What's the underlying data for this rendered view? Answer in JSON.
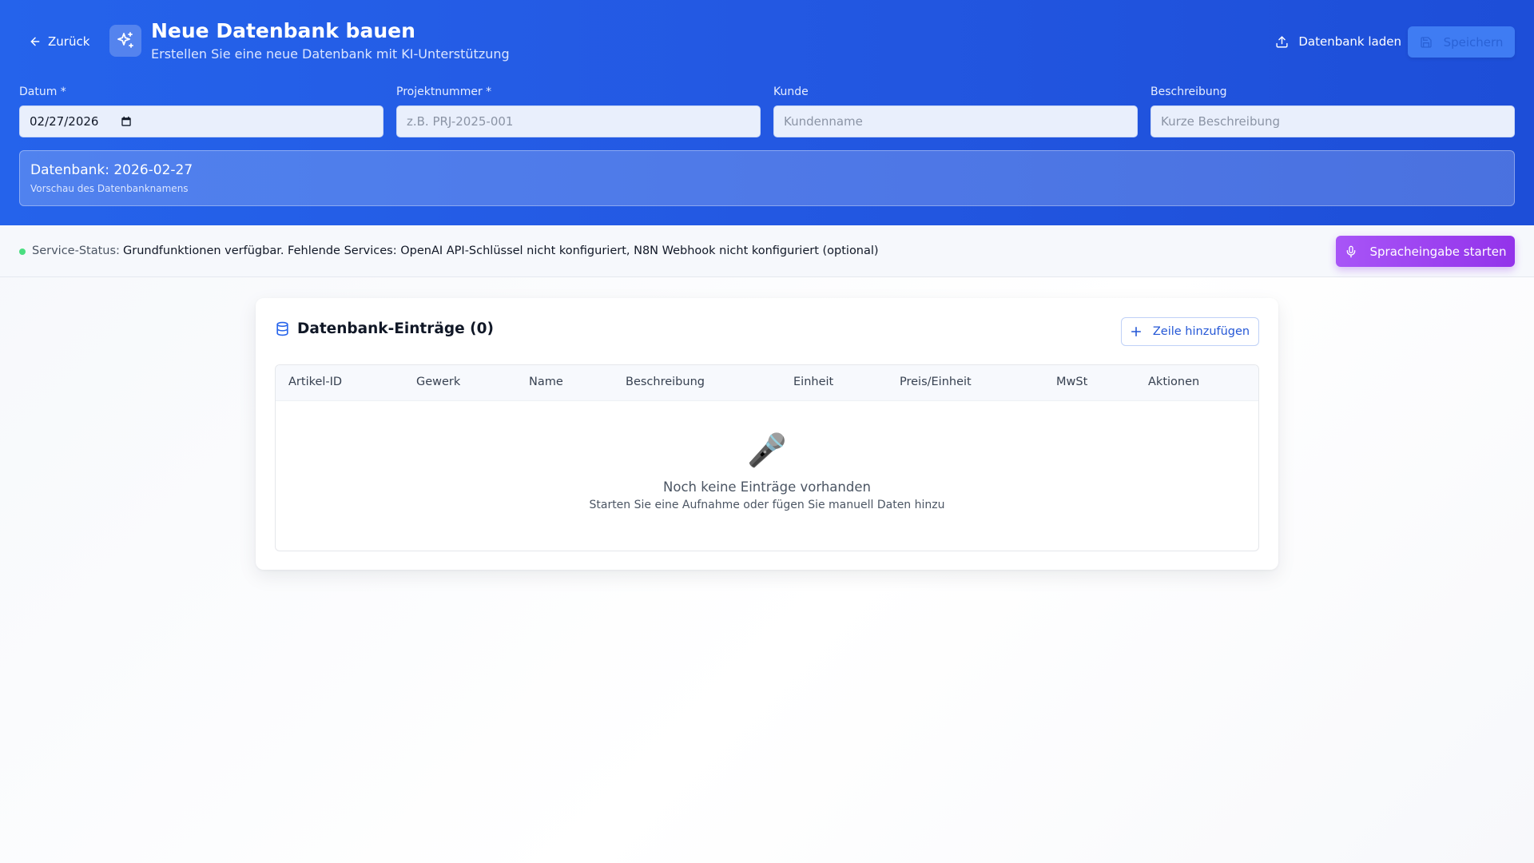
{
  "header": {
    "back_label": "Zurück",
    "title": "Neue Datenbank bauen",
    "subtitle": "Erstellen Sie eine neue Datenbank mit KI-Unterstützung",
    "load_label": "Datenbank laden",
    "save_label": "Speichern",
    "icons": {
      "back": "arrow-left-icon",
      "app": "sparkles-icon",
      "load": "upload-icon",
      "save": "floppy-disk-icon",
      "calendar": "calendar-icon"
    }
  },
  "form": {
    "date": {
      "label": "Datum *",
      "value": "02/27/2026"
    },
    "project": {
      "label": "Projektnummer *",
      "placeholder": "z.B. PRJ-2025-001"
    },
    "customer": {
      "label": "Kunde",
      "placeholder": "Kundenname"
    },
    "description": {
      "label": "Beschreibung",
      "placeholder": "Kurze Beschreibung"
    }
  },
  "preview": {
    "title": "Datenbank: 2026-02-27",
    "subtitle": "Vorschau des Datenbanknamens"
  },
  "status": {
    "label": "Service-Status:",
    "text": "Grundfunktionen verfügbar. Fehlende Services: OpenAI API-Schlüssel nicht konfiguriert, N8N Webhook nicht konfiguriert (optional)",
    "indicator_color": "#4ade80",
    "voice_button_label": "Spracheingabe starten",
    "icons": {
      "voice": "microphone-icon"
    }
  },
  "card": {
    "title": "Datenbank-Einträge (0)",
    "add_row_label": "Zeile hinzufügen",
    "columns": [
      "Artikel-ID",
      "Gewerk",
      "Name",
      "Beschreibung",
      "Einheit",
      "Preis/Einheit",
      "MwSt",
      "Aktionen"
    ],
    "empty": {
      "icon": "🎤",
      "title": "Noch keine Einträge vorhanden",
      "subtitle": "Starten Sie eine Aufnahme oder fügen Sie manuell Daten hinzu"
    },
    "icons": {
      "title": "database-icon",
      "add": "plus-icon"
    }
  },
  "colors": {
    "header_bg": "#2563eb",
    "accent_purple": "#9333ea",
    "accent_blue": "#2457d6"
  }
}
